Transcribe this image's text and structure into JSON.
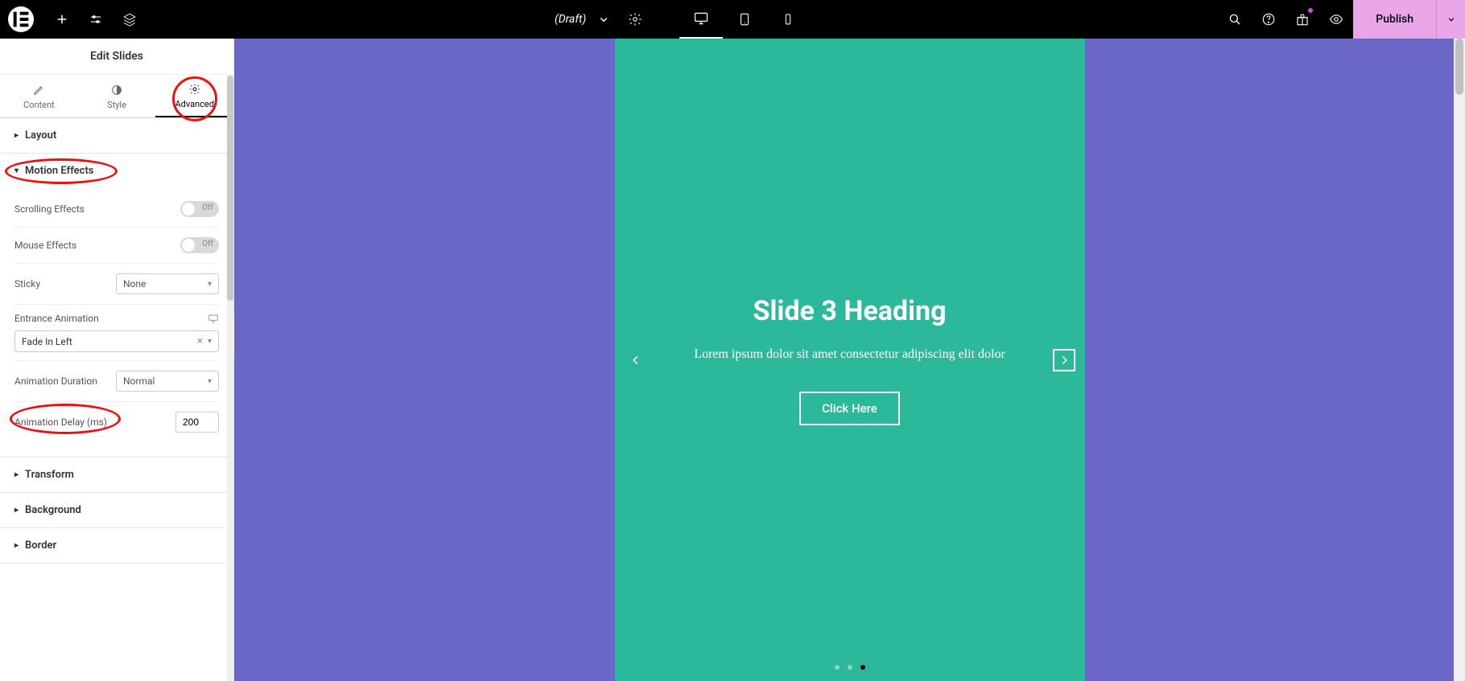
{
  "topbar": {
    "draft_label": "(Draft)",
    "publish_label": "Publish"
  },
  "panel": {
    "title": "Edit Slides",
    "tabs": {
      "content": "Content",
      "style": "Style",
      "advanced": "Advanced"
    },
    "sections": {
      "layout": "Layout",
      "motion_effects": "Motion Effects",
      "transform": "Transform",
      "background": "Background",
      "border": "Border"
    },
    "motion": {
      "scrolling_label": "Scrolling Effects",
      "scrolling_state": "Off",
      "mouse_label": "Mouse Effects",
      "mouse_state": "Off",
      "sticky_label": "Sticky",
      "sticky_value": "None",
      "entrance_label": "Entrance Animation",
      "entrance_value": "Fade In Left",
      "duration_label": "Animation Duration",
      "duration_value": "Normal",
      "delay_label": "Animation Delay (ms)",
      "delay_value": "200"
    }
  },
  "slide": {
    "heading": "Slide 3 Heading",
    "description": "Lorem ipsum dolor sit amet consectetur adipiscing elit dolor",
    "button": "Click Here",
    "active_dot": 3,
    "total_dots": 3
  },
  "colors": {
    "canvas_bg": "#6b67c6",
    "slide_bg": "#2cb89a",
    "publish_bg": "#e8a5e8",
    "highlight": "#e11"
  }
}
